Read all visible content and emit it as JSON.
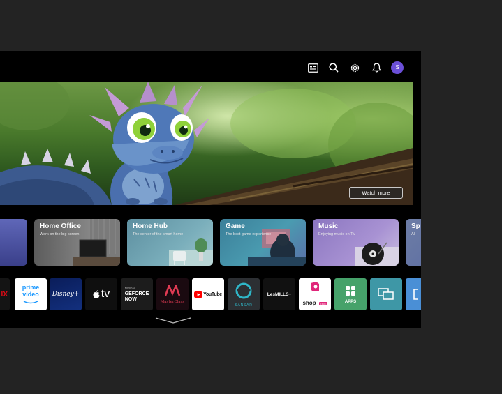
{
  "topbar": {
    "icons": [
      "guide-icon",
      "search-icon",
      "settings-icon",
      "notification-icon"
    ],
    "avatar_initial": "S"
  },
  "hero": {
    "watch_label": "Watch more"
  },
  "cards": [
    {
      "title": "Home Office",
      "subtitle": "Work on the big screen"
    },
    {
      "title": "Home Hub",
      "subtitle": "The center of the smart home"
    },
    {
      "title": "Game",
      "subtitle": "The best game experience"
    },
    {
      "title": "Music",
      "subtitle": "Enjoying music on TV"
    },
    {
      "title": "Sp",
      "subtitle": "All"
    }
  ],
  "apps": {
    "netflix": "IX",
    "prime_top": "prime",
    "prime_bottom": "video",
    "disney": "Disney+",
    "appletv": "tv",
    "geforce_top": "NVIDIA",
    "geforce_line1": "GEFORCE",
    "geforce_line2": "NOW",
    "masterclass": "MasterClass",
    "youtube": "YouTube",
    "sansar": "SANSAR",
    "lesmills": "LesMILLS+",
    "shop": "shop",
    "shop_tag": "TIME",
    "apps": "APPS"
  },
  "colors": {
    "tv_bg": "#000000",
    "page_bg": "#232323",
    "avatar": "#6b4fd8",
    "home_office": "#6f6f6f",
    "home_hub": "#6f9fae",
    "game": "#4a8fa5",
    "music": "#9e87c9",
    "apps_tile": "#46a26a",
    "screen_share": "#3e97a6"
  }
}
